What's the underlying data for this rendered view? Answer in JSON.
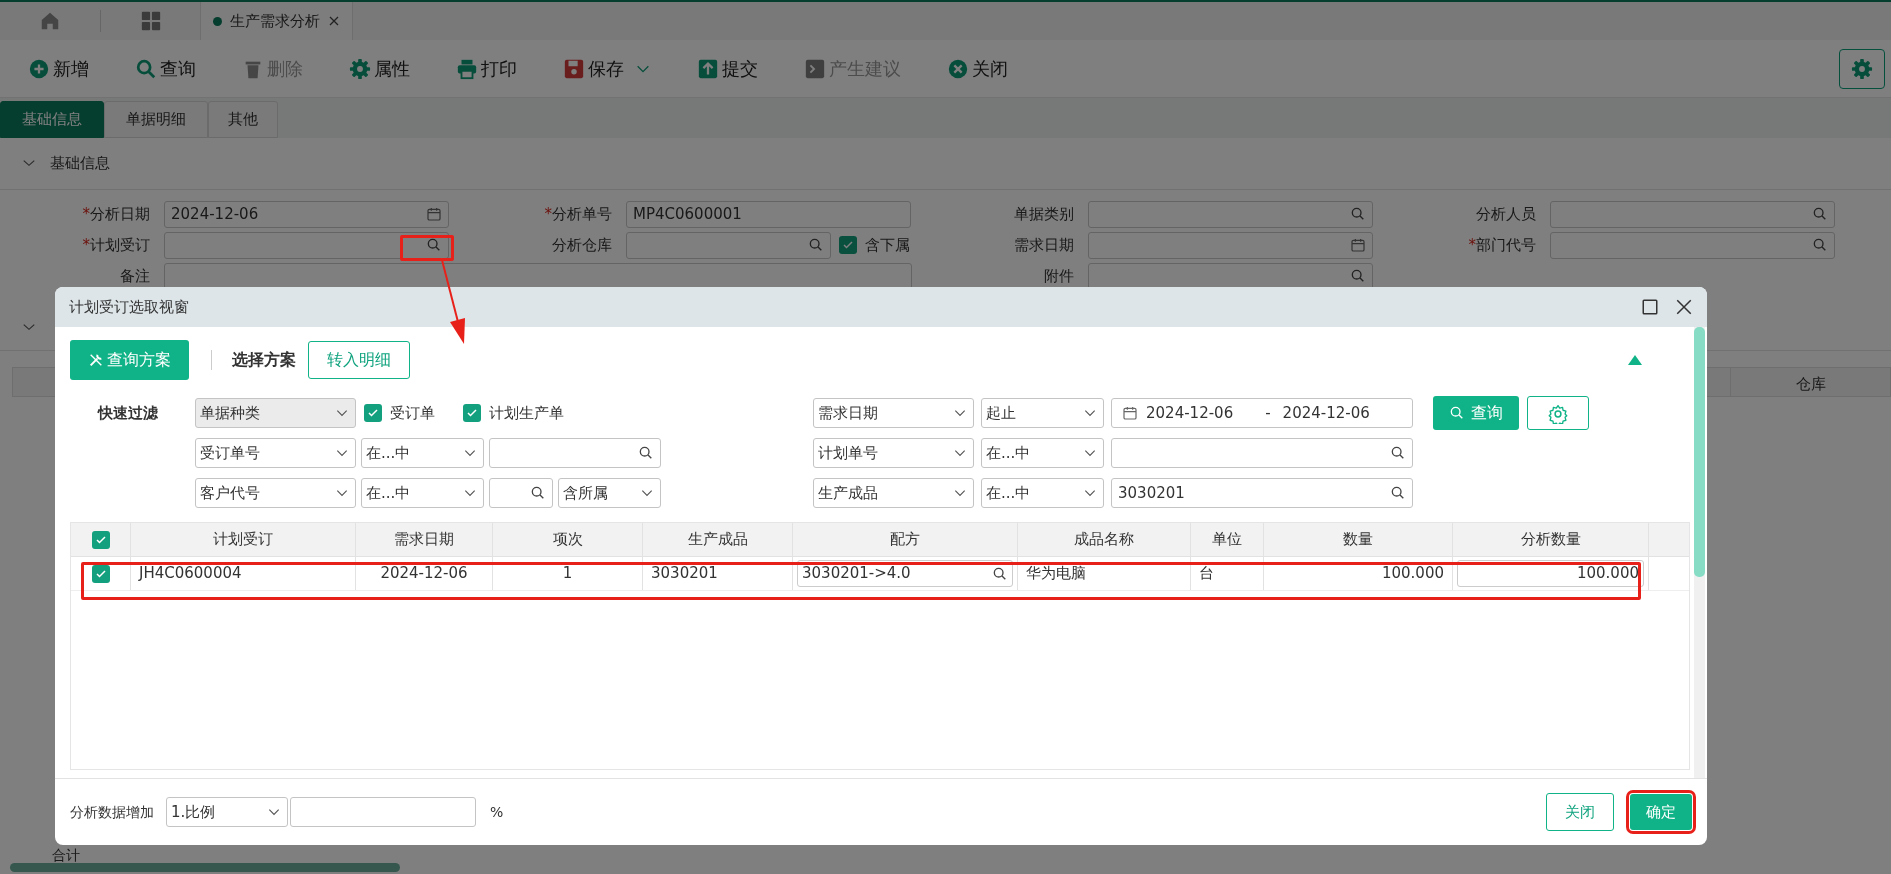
{
  "top_tabs": [
    {
      "label": "生产需求分析",
      "selected": true
    }
  ],
  "toolbar": [
    {
      "label": "新增",
      "kind": "add",
      "disabled": false
    },
    {
      "label": "查询",
      "kind": "search",
      "disabled": false
    },
    {
      "label": "删除",
      "kind": "delete",
      "disabled": true
    },
    {
      "label": "属性",
      "kind": "gear",
      "disabled": false
    },
    {
      "label": "打印",
      "kind": "print",
      "disabled": false
    },
    {
      "label": "保存",
      "kind": "save",
      "disabled": false,
      "dropdown": true
    },
    {
      "label": "提交",
      "kind": "submit",
      "disabled": false
    },
    {
      "label": "产生建议",
      "kind": "terminal",
      "disabled": true
    },
    {
      "label": "关闭",
      "kind": "close",
      "disabled": false
    }
  ],
  "page_tabs": [
    {
      "label": "基础信息",
      "selected": true
    },
    {
      "label": "单据明细",
      "selected": false
    },
    {
      "label": "其他",
      "selected": false
    }
  ],
  "section": {
    "title": "基础信息",
    "expanded": true
  },
  "form": [
    [
      {
        "label": "分析日期",
        "required": true,
        "kind": "date",
        "value": "2024-12-06"
      },
      {
        "label": "分析单号",
        "required": true,
        "kind": "text",
        "value": "MP4C0600001"
      },
      {
        "label": "单据类别",
        "required": false,
        "kind": "lookup"
      },
      {
        "label": "分析人员",
        "required": false,
        "kind": "lookup"
      }
    ],
    [
      {
        "label": "计划受订",
        "required": true,
        "kind": "lookup"
      },
      {
        "label": "分析仓库",
        "required": false,
        "kind": "lookup",
        "checkbox": {
          "label": "含下属",
          "checked": true
        }
      },
      {
        "label": "需求日期",
        "required": false,
        "kind": "date"
      },
      {
        "label": "部门代号",
        "required": true,
        "kind": "lookup"
      }
    ],
    [
      {
        "label": "备注",
        "required": false,
        "kind": "wide"
      },
      {
        "label": "附件",
        "required": false,
        "kind": "lookup"
      }
    ]
  ],
  "required_mark": "*",
  "background_table": {
    "columns": [
      "仓库"
    ],
    "footer": "合计"
  },
  "dialog": {
    "title": "计划受订选取视窗",
    "scheme_button": "查询方案",
    "scheme_label": "选择方案",
    "transfer_button": "转入明细",
    "filter_label": "快速过滤",
    "filters": [
      {
        "left": [
          {
            "kind": "select",
            "value": "单据种类",
            "disabled": true
          },
          {
            "kind": "check",
            "label": "受订单",
            "checked": true
          },
          {
            "kind": "check",
            "label": "计划生产单",
            "checked": true
          }
        ],
        "right": [
          {
            "kind": "select",
            "value": "需求日期"
          },
          {
            "kind": "op",
            "value": "起止"
          },
          {
            "kind": "daterange",
            "from": "2024-12-06",
            "to": "2024-12-06",
            "sep": "-"
          }
        ]
      },
      {
        "left": [
          {
            "kind": "select",
            "value": "受订单号"
          },
          {
            "kind": "op",
            "value": "在...中"
          },
          {
            "kind": "search"
          }
        ],
        "right": [
          {
            "kind": "select",
            "value": "计划单号"
          },
          {
            "kind": "op",
            "value": "在...中"
          },
          {
            "kind": "search"
          }
        ]
      },
      {
        "left": [
          {
            "kind": "select",
            "value": "客户代号"
          },
          {
            "kind": "op",
            "value": "在...中"
          },
          {
            "kind": "search"
          },
          {
            "kind": "small-select",
            "value": "含所属"
          }
        ],
        "right": [
          {
            "kind": "select",
            "value": "生产成品"
          },
          {
            "kind": "op",
            "value": "在...中"
          },
          {
            "kind": "search",
            "value": "3030201"
          }
        ]
      }
    ],
    "query_button": "查询",
    "table": {
      "all_checked": true,
      "columns": [
        "计划受订",
        "需求日期",
        "项次",
        "生产成品",
        "配方",
        "成品名称",
        "单位",
        "数量",
        "分析数量"
      ],
      "rows": [
        {
          "checked": true,
          "cells": [
            "JH4C0600004",
            "2024-12-06",
            "1",
            "3030201",
            "3030201->4.0",
            "华为电脑",
            "台",
            "100.000",
            "100.000"
          ]
        }
      ]
    },
    "footer": {
      "label": "分析数据增加",
      "mode": "1.比例",
      "unit": "%",
      "cancel": "关闭",
      "ok": "确定"
    }
  }
}
